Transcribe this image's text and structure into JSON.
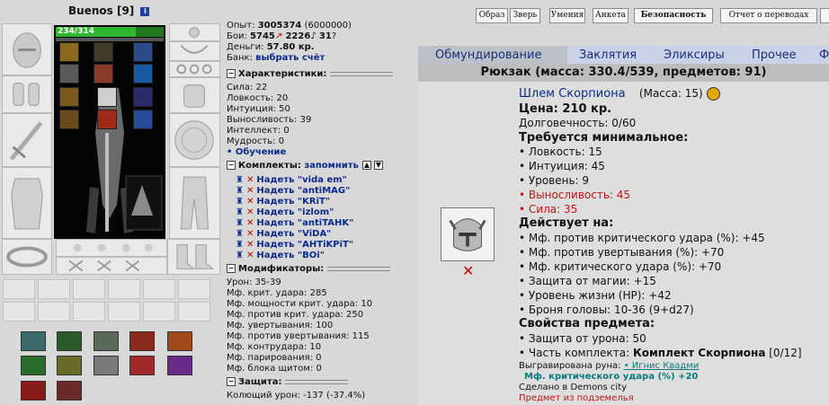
{
  "character": {
    "name": "Buenos",
    "level": "[9]",
    "info_icon": "info-icon",
    "hp": "234/314",
    "hp_fraction": 0.745
  },
  "stats_top": {
    "experience_label": "Опыт:",
    "experience": "3005374",
    "experience_next": "(6000000)",
    "battles_label": "Бои:",
    "wins": "5745",
    "losses": "2226",
    "draws": "31",
    "money_label": "Деньги:",
    "money": "57.80 кр.",
    "bank_label": "Банк:",
    "bank_link": "выбрать счёт"
  },
  "characteristics": {
    "title": "Характеристики:",
    "items": [
      "Сила: 22",
      "Ловкость: 20",
      "Интуиция: 50",
      "Выносливость: 39",
      "Интеллект: 0",
      "Мудрость: 0"
    ],
    "training": "Обучение"
  },
  "sets": {
    "title": "Комплекты:",
    "remember": "запомнить",
    "items": [
      "Надеть \"vida em\"",
      "Надеть \"antiMAG\"",
      "Надеть \"KRiT\"",
      "Надеть \"izlom\"",
      "Надеть \"antiTAHK\"",
      "Надеть \"ViDA\"",
      "Надеть \"AHTiKPiT\"",
      "Надеть \"BOi\""
    ]
  },
  "modifiers": {
    "title": "Модификаторы:",
    "items": [
      "Урон: 35-39",
      "Мф. крит. удара: 285",
      "Мф. мощности крит. удара: 10",
      "Мф. против крит. удара: 250",
      "Мф. увертывания: 100",
      "Мф. против увертывания: 115",
      "Мф. контрудара: 10",
      "Мф. парирования: 0",
      "Мф. блока щитом: 0"
    ]
  },
  "defense": {
    "title": "Защита:",
    "items": [
      "Колющий урон: -137 (-37.4%)"
    ]
  },
  "top_buttons": [
    "Образ",
    "Зверь",
    "Умения",
    "Анкета",
    "Безопасность",
    "Отчет о переводах"
  ],
  "tabs": [
    "Обмундирование",
    "Заклятия",
    "Эликсиры",
    "Прочее",
    "Ф"
  ],
  "backpack": "Рюкзак (масса: 330.4/539, предметов: 91)",
  "item": {
    "name": "Шлем Скорпиона",
    "mass": "(Масса: 15)",
    "price": "Цена: 210 кр.",
    "durability": "Долговечность: 0/60",
    "requirements_title": "Требуется минимальное:",
    "requirements": [
      {
        "text": "• Ловкость: 15",
        "color": "#111111"
      },
      {
        "text": "• Интуиция: 45",
        "color": "#111111"
      },
      {
        "text": "• Уровень: 9",
        "color": "#111111"
      },
      {
        "text": "• Выносливость: 45",
        "color": "#c41414"
      },
      {
        "text": "• Сила: 35",
        "color": "#c41414"
      }
    ],
    "effects_title": "Действует на:",
    "effects": [
      "• Мф. против критического удара (%): +45",
      "• Мф. против увертывания (%): +70",
      "• Мф. критического удара (%): +70",
      "• Защита от магии: +15",
      "• Уровень жизни (HP): +42",
      "• Броня головы: 10-36 (9+d27)"
    ],
    "properties_title": "Свойства предмета:",
    "protection": "• Защита от урона: 50",
    "set_prefix": "• Часть комплекта: ",
    "set_name": "Комплект Скорпиона",
    "set_count": " [0/12]",
    "rune_label": "Выгравирована руна:",
    "rune_name": "• Игнис Квадми",
    "rune_effect": "Мф. критического удара (%) +20",
    "made_in": "Сделано в Demons city",
    "dungeon": "Предмет из подземелья",
    "remove_icon": "red-x-icon"
  }
}
